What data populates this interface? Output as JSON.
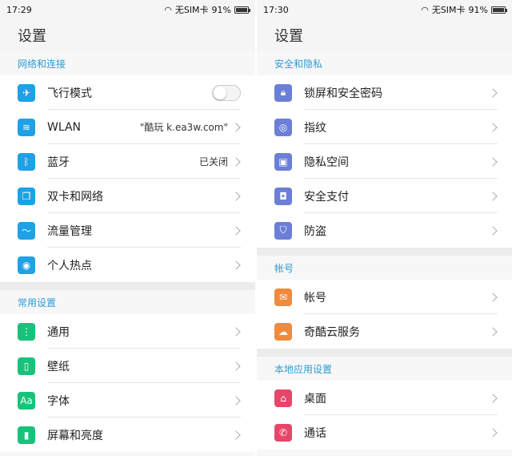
{
  "left": {
    "status": {
      "time": "17:29",
      "carrier": "无SIM卡",
      "battery": "91%"
    },
    "title": "设置",
    "sections": [
      {
        "header": "网络和连接",
        "items": [
          {
            "label": "飞行模式",
            "icon": "airplane-icon",
            "color": "#1ea1e6"
          },
          {
            "label": "WLAN",
            "value": "\"酷玩 k.ea3w.com\"",
            "icon": "wifi-icon",
            "color": "#1ea1e6"
          },
          {
            "label": "蓝牙",
            "value": "已关闭",
            "icon": "bluetooth-icon",
            "color": "#1ea1e6"
          },
          {
            "label": "双卡和网络",
            "icon": "sim-card-icon",
            "color": "#1ea1e6"
          },
          {
            "label": "流量管理",
            "icon": "data-usage-icon",
            "color": "#1ea1e6"
          },
          {
            "label": "个人热点",
            "icon": "hotspot-icon",
            "color": "#1ea1e6"
          }
        ]
      },
      {
        "header": "常用设置",
        "items": [
          {
            "label": "通用",
            "icon": "menu-dots-icon",
            "color": "#19c27a"
          },
          {
            "label": "壁纸",
            "icon": "wallpaper-icon",
            "color": "#19c27a"
          },
          {
            "label": "字体",
            "icon": "font-icon",
            "color": "#19c27a"
          },
          {
            "label": "屏幕和亮度",
            "icon": "phone-screen-icon",
            "color": "#19c27a"
          }
        ]
      }
    ]
  },
  "right": {
    "status": {
      "time": "17:30",
      "carrier": "无SIM卡",
      "battery": "91%"
    },
    "title": "设置",
    "sections": [
      {
        "header": "安全和隐私",
        "items": [
          {
            "label": "锁屏和安全密码",
            "icon": "lock-icon",
            "color": "#6c7fd6"
          },
          {
            "label": "指纹",
            "icon": "fingerprint-icon",
            "color": "#6c7fd6"
          },
          {
            "label": "隐私空间",
            "icon": "private-space-icon",
            "color": "#6c7fd6"
          },
          {
            "label": "安全支付",
            "icon": "secure-pay-icon",
            "color": "#6c7fd6"
          },
          {
            "label": "防盗",
            "icon": "shield-icon",
            "color": "#6c7fd6"
          }
        ]
      },
      {
        "header": "帐号",
        "items": [
          {
            "label": "帐号",
            "icon": "mail-icon",
            "color": "#f08a3c"
          },
          {
            "label": "奇酷云服务",
            "icon": "cloud-icon",
            "color": "#f08a3c"
          }
        ]
      },
      {
        "header": "本地应用设置",
        "items": [
          {
            "label": "桌面",
            "icon": "home-icon",
            "color": "#e5476a"
          },
          {
            "label": "通话",
            "icon": "phone-icon",
            "color": "#e5476a"
          }
        ]
      }
    ]
  }
}
